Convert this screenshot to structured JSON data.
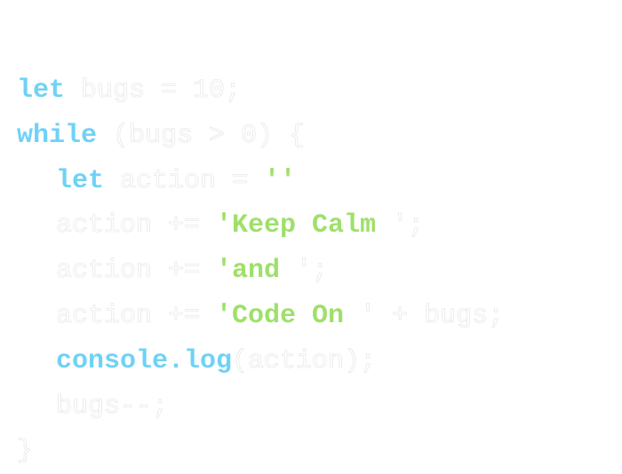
{
  "code": {
    "lines": [
      {
        "indent": 0,
        "tokens": [
          {
            "type": "kw",
            "text": "let"
          },
          {
            "type": "plain",
            "text": " bugs = 10;"
          }
        ]
      },
      {
        "indent": 0,
        "tokens": [
          {
            "type": "kw",
            "text": "while"
          },
          {
            "type": "plain",
            "text": " (bugs > 0) {"
          }
        ]
      },
      {
        "indent": 1,
        "tokens": [
          {
            "type": "kw",
            "text": "let"
          },
          {
            "type": "plain",
            "text": " action = "
          },
          {
            "type": "str",
            "text": "''"
          }
        ]
      },
      {
        "indent": 1,
        "tokens": [
          {
            "type": "plain",
            "text": "action += "
          },
          {
            "type": "str",
            "text": "'Keep Calm "
          },
          {
            "type": "plain",
            "text": "';"
          }
        ]
      },
      {
        "indent": 1,
        "tokens": [
          {
            "type": "plain",
            "text": "action += "
          },
          {
            "type": "str",
            "text": "'and "
          },
          {
            "type": "plain",
            "text": "';"
          }
        ]
      },
      {
        "indent": 1,
        "tokens": [
          {
            "type": "plain",
            "text": "action += "
          },
          {
            "type": "str",
            "text": "'Code On "
          },
          {
            "type": "plain",
            "text": "' + bugs;"
          }
        ]
      },
      {
        "indent": 1,
        "tokens": [
          {
            "type": "kw",
            "text": "console.log"
          },
          {
            "type": "plain",
            "text": "(action);"
          }
        ]
      },
      {
        "indent": 1,
        "tokens": [
          {
            "type": "plain",
            "text": "bugs--;"
          }
        ]
      },
      {
        "indent": 0,
        "tokens": [
          {
            "type": "plain",
            "text": "}"
          }
        ]
      }
    ]
  },
  "colors": {
    "background": "#ffffff",
    "keyword": "#6fd2f5",
    "string": "#9ee06a",
    "plain": "#ffffff",
    "plain_outline": "#e2e2e2"
  }
}
